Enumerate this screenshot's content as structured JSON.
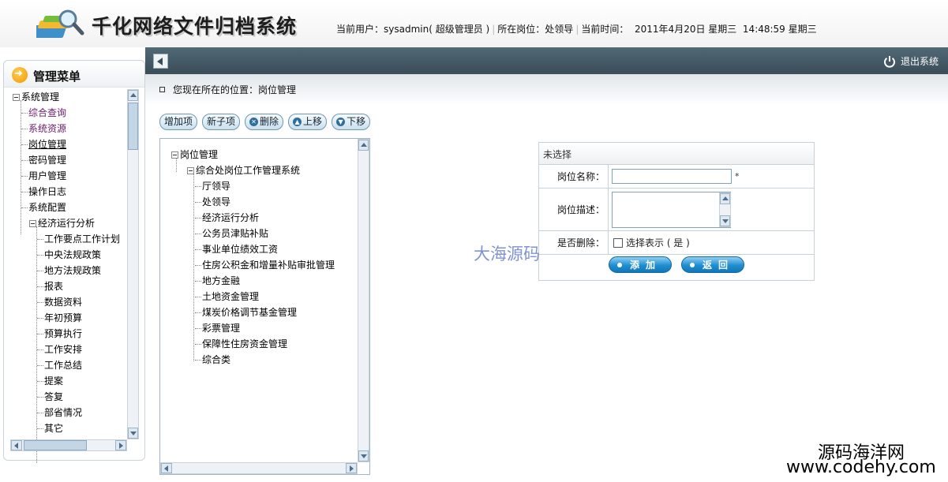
{
  "header": {
    "app_title": "千化网络文件归档系统",
    "current_user_label": "当前用户：",
    "current_user": "sysadmin",
    "user_role": "( 超级管理员   )",
    "position_label": "所在岗位：",
    "position": "处领导",
    "time_label": "当前时间：",
    "date": "2011年4月20日  星期三",
    "time": "14:48:59 星期三"
  },
  "topbar": {
    "logout_label": "退出系统"
  },
  "sidebar": {
    "title": "管理菜单",
    "root": "系统管理",
    "items": [
      "综合查询",
      "系统资源",
      "岗位管理",
      "密码管理",
      "用户管理",
      "操作日志",
      "系统配置"
    ],
    "selected": "岗位管理",
    "group": "经济运行分析",
    "sub_items": [
      "工作要点工作计划",
      "中央法规政策",
      "地方法规政策",
      "报表",
      "数据资料",
      "年初预算",
      "预算执行",
      "工作安排",
      "工作总结",
      "提案",
      "答复",
      "部省情况",
      "其它"
    ]
  },
  "breadcrumb": {
    "label": "您现在所在的位置：岗位管理"
  },
  "toolbar": {
    "add_label": "增加项",
    "add_child_label": "新子项",
    "delete_label": "删除",
    "move_up_label": "上移",
    "move_down_label": "下移"
  },
  "position_tree": {
    "root": "岗位管理",
    "branch": "综合处岗位工作管理系统",
    "children": [
      "厅领导",
      "处领导",
      "经济运行分析",
      "公务员津贴补贴",
      "事业单位绩效工资",
      "住房公积金和增量补贴审批管理",
      "地方金融",
      "土地资金管理",
      "煤炭价格调节基金管理",
      "彩票管理",
      "保障性住房资金管理",
      "综合类"
    ]
  },
  "form": {
    "header": "未选择",
    "name_label": "岗位名称：",
    "name_value": "",
    "required_mark": "*",
    "desc_label": "岗位描述：",
    "desc_value": "",
    "deleted_label": "是否删除：",
    "deleted_checkbox_label": "选择表示 ( 是 )",
    "add_button": "添加",
    "back_button": "返回"
  },
  "watermarks": {
    "center": "大海源码",
    "corner_cn": "源码海洋网",
    "corner_url": "www.codehy.com"
  }
}
